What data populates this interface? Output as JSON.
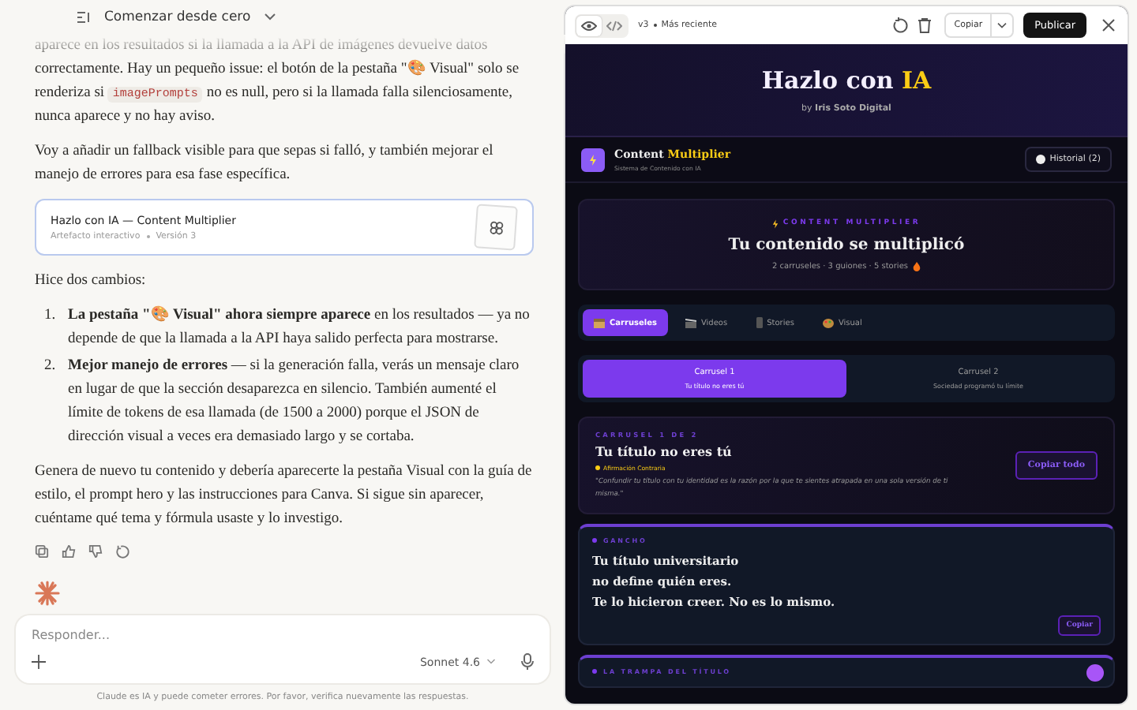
{
  "chat_header": {
    "title": "Comenzar desde cero"
  },
  "messages": [
    {
      "kind": "paragraph",
      "parts": [
        {
          "kind": "text",
          "text": "aparece en los resultados si la llamada a la API de imágenes devuelve datos correctamente. Hay un pequeño issue: el botón de la pestaña \"🎨 Visual\" solo se renderiza si "
        },
        {
          "kind": "code",
          "text": "imagePrompts"
        },
        {
          "kind": "text",
          "text": " no es null, pero si la llamada falla silenciosamente, nunca aparece y no hay aviso."
        }
      ]
    },
    {
      "kind": "paragraph",
      "parts": [
        {
          "kind": "text",
          "text": "Voy a añadir un fallback visible para que sepas si falló, y también mejorar el manejo de errores para esa fase específica."
        }
      ]
    },
    {
      "kind": "artifact",
      "title": "Hazlo con IA — Content Multiplier",
      "type": "Artefacto interactivo",
      "version": "Versión 3"
    },
    {
      "kind": "paragraph",
      "parts": [
        {
          "kind": "text",
          "text": "Hice dos cambios:"
        }
      ]
    },
    {
      "kind": "list",
      "items": [
        {
          "number": "1.",
          "text": "**La pestaña \"🎨 Visual\" ahora siempre aparece** en los resultados — ya no depende de que la llamada a la API haya salido perfecta para mostrarse."
        },
        {
          "number": "2.",
          "text": "**Mejor manejo de errores** — si la generación falla, verás un mensaje claro en lugar de que la sección desaparezca en silencio. También aumenté el límite de tokens de esa llamada (de 1500 a 2000) porque el JSON de dirección visual a veces era demasiado largo y se cortaba."
        }
      ]
    },
    {
      "kind": "paragraph",
      "parts": [
        {
          "kind": "text",
          "text": "Genera de nuevo tu contenido y debería aparecerte la pestaña Visual con la guía de estilo, el prompt hero y las instrucciones para Canva. Si sigue sin aparecer, cuéntame qué tema y fórmula usaste y lo investigo."
        }
      ]
    }
  ],
  "composer": {
    "placeholder": "Responder...",
    "model": "Sonnet 4.6"
  },
  "disclaimer": "Claude es IA y puede cometer errores. Por favor, verifica nuevamente las respuestas.",
  "artifact_panel": {
    "view_modes": [
      {
        "kind": "preview",
        "selected": true
      },
      {
        "kind": "code",
        "selected": false
      }
    ],
    "version": "v3",
    "version_note": "Más reciente",
    "copy_label": "Copiar",
    "publish_label": "Publicar",
    "app": {
      "hero": {
        "title": "Hazlo con ",
        "title_highlight": "IA",
        "byline": "by **Iris Soto Digital**"
      },
      "brand": {
        "name": "Content ",
        "name_highlight": "Multiplier",
        "subtitle": "Sistema de Contenido con IA",
        "history_label": "Historial (2)"
      },
      "summary": {
        "eyebrow": "CONTENT MULTIPLIER",
        "title": "Tu contenido se multiplicó",
        "stats": "2 carruseles · 3 guiones · 5 stories"
      },
      "tabs": [
        {
          "kind": "carousel",
          "label": "Carruseles",
          "selected": true
        },
        {
          "kind": "video",
          "label": "Videos",
          "selected": false
        },
        {
          "kind": "story",
          "label": "Stories",
          "selected": false
        },
        {
          "kind": "visual",
          "label": "Visual",
          "selected": false
        }
      ],
      "carousels": [
        {
          "title": "Carrusel 1",
          "subtitle": "Tu título no eres tú",
          "selected": true
        },
        {
          "title": "Carrusel 2",
          "subtitle": "Sociedad programó tu límite",
          "selected": false
        }
      ],
      "carousel_card": {
        "eyebrow": "CARRUSEL 1 DE 2",
        "title": "Tu título no eres tú",
        "formula": "Afirmación Contraria",
        "quote": "\"Confundir tu título con tu identidad es la razón por la que te sientes atrapada en una sola versión de ti misma.\"",
        "button": "Copiar todo"
      },
      "slides": [
        {
          "label": "GANCHO",
          "lines": [
            "Tu título universitario",
            "no define quién eres.",
            "Te lo hicieron creer. No es lo mismo."
          ],
          "button": "Copiar"
        },
        {
          "label": "LA TRAMPA DEL TÍTULO"
        }
      ]
    }
  }
}
